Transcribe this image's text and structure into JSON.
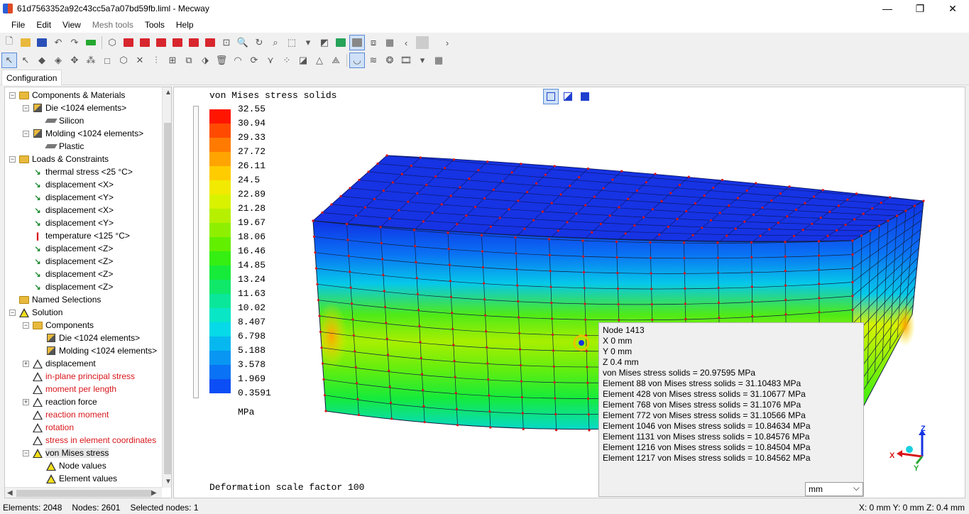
{
  "window": {
    "title": "61d7563352a92c43cc5a7a07bd59fb.liml - Mecway",
    "buttons": [
      "—",
      "❐",
      "✕"
    ]
  },
  "menu": [
    {
      "label": "File",
      "enabled": true
    },
    {
      "label": "Edit",
      "enabled": true
    },
    {
      "label": "View",
      "enabled": true
    },
    {
      "label": "Mesh tools",
      "enabled": false
    },
    {
      "label": "Tools",
      "enabled": true
    },
    {
      "label": "Help",
      "enabled": true
    }
  ],
  "tabs": {
    "configuration": "Configuration"
  },
  "tree": [
    {
      "label": "Components & Materials",
      "level": 0,
      "icon": "folder-icon",
      "toggle": "−"
    },
    {
      "label": "Die <1024 elements>",
      "level": 1,
      "icon": "component-icon",
      "toggle": "−"
    },
    {
      "label": "Silicon",
      "level": 2,
      "icon": "material-icon",
      "toggle": ""
    },
    {
      "label": "Molding <1024 elements>",
      "level": 1,
      "icon": "component-icon",
      "toggle": "−"
    },
    {
      "label": "Plastic",
      "level": 2,
      "icon": "material-icon",
      "toggle": ""
    },
    {
      "label": "Loads & Constraints",
      "level": 0,
      "icon": "folder-icon",
      "toggle": "−"
    },
    {
      "label": "thermal stress <25 °C>",
      "level": 1,
      "icon": "load-icon",
      "toggle": ""
    },
    {
      "label": "displacement <X>",
      "level": 1,
      "icon": "load-icon",
      "toggle": ""
    },
    {
      "label": "displacement <Y>",
      "level": 1,
      "icon": "load-icon",
      "toggle": ""
    },
    {
      "label": "displacement <X>",
      "level": 1,
      "icon": "load-icon",
      "toggle": ""
    },
    {
      "label": "displacement <Y>",
      "level": 1,
      "icon": "load-icon",
      "toggle": ""
    },
    {
      "label": "temperature <125 °C>",
      "level": 1,
      "icon": "thermometer-icon",
      "toggle": ""
    },
    {
      "label": "displacement <Z>",
      "level": 1,
      "icon": "load-icon",
      "toggle": ""
    },
    {
      "label": "displacement <Z>",
      "level": 1,
      "icon": "load-icon",
      "toggle": ""
    },
    {
      "label": "displacement <Z>",
      "level": 1,
      "icon": "load-icon",
      "toggle": ""
    },
    {
      "label": "displacement <Z>",
      "level": 1,
      "icon": "load-icon",
      "toggle": ""
    },
    {
      "label": "Named Selections",
      "level": 0,
      "icon": "folder-icon",
      "toggle": ""
    },
    {
      "label": "Solution",
      "level": 0,
      "icon": "solution-icon",
      "toggle": "−"
    },
    {
      "label": "Components",
      "level": 1,
      "icon": "folder-icon",
      "toggle": "−"
    },
    {
      "label": "Die <1024 elements>",
      "level": 2,
      "icon": "component-icon",
      "toggle": ""
    },
    {
      "label": "Molding <1024 elements>",
      "level": 2,
      "icon": "component-icon",
      "toggle": ""
    },
    {
      "label": "displacement",
      "level": 1,
      "icon": "result-icon",
      "toggle": "+"
    },
    {
      "label": "in-plane principal stress",
      "level": 1,
      "icon": "result-icon",
      "toggle": "",
      "red": true
    },
    {
      "label": "moment per length",
      "level": 1,
      "icon": "result-icon",
      "toggle": "",
      "red": true
    },
    {
      "label": "reaction force",
      "level": 1,
      "icon": "result-icon",
      "toggle": "+"
    },
    {
      "label": "reaction moment",
      "level": 1,
      "icon": "result-icon",
      "toggle": "",
      "red": true
    },
    {
      "label": "rotation",
      "level": 1,
      "icon": "result-icon",
      "toggle": "",
      "red": true
    },
    {
      "label": "stress in element coordinates",
      "level": 1,
      "icon": "result-icon",
      "toggle": "",
      "red": true
    },
    {
      "label": "von Mises stress",
      "level": 1,
      "icon": "result-icon",
      "toggle": "−",
      "selected": true
    },
    {
      "label": "Node values",
      "level": 2,
      "icon": "result-icon",
      "toggle": ""
    },
    {
      "label": "Element values",
      "level": 2,
      "icon": "result-icon",
      "toggle": ""
    }
  ],
  "legend": {
    "title": "von Mises stress solids",
    "unit": "MPa",
    "values": [
      "32.55",
      "30.94",
      "29.33",
      "27.72",
      "26.11",
      "24.5",
      "22.89",
      "21.28",
      "19.67",
      "18.06",
      "16.46",
      "14.85",
      "13.24",
      "11.63",
      "10.02",
      "8.407",
      "6.798",
      "5.188",
      "3.578",
      "1.969",
      "0.3591"
    ],
    "colors": [
      "#ff1500",
      "#ff4a00",
      "#ff7a00",
      "#ffa400",
      "#ffcc00",
      "#f2ea00",
      "#d8f200",
      "#b6f000",
      "#8ef000",
      "#62ef00",
      "#35ee12",
      "#16eb3a",
      "#10e86a",
      "#0ae79a",
      "#08e6c6",
      "#06d9e8",
      "#06b8ef",
      "#0896f2",
      "#0a72f4",
      "#0c4ef5",
      "#0e22f4"
    ]
  },
  "deformation": "Deformation scale factor 100",
  "node_info": {
    "lines": [
      "Node  1413",
      "X  0 mm",
      "Y  0 mm",
      "Z  0.4 mm",
      "von Mises stress solids = 20.97595 MPa",
      "Element 88 von Mises stress solids = 31.10483 MPa",
      "Element 428 von Mises stress solids = 31.10677 MPa",
      "Element 768 von Mises stress solids = 31.1076 MPa",
      "Element 772 von Mises stress solids = 31.10566 MPa",
      "Element 1046 von Mises stress solids = 10.84634 MPa",
      "Element 1131 von Mises stress solids = 10.84576 MPa",
      "Element 1216 von Mises stress solids = 10.84504 MPa",
      "Element 1217 von Mises stress solids = 10.84562 MPa"
    ],
    "unit_select": "mm"
  },
  "axes": {
    "x": "X",
    "y": "Y",
    "z": "Z"
  },
  "status": {
    "elements": "Elements: 2048",
    "nodes": "Nodes: 2601",
    "selected": "Selected nodes: 1",
    "coords": "X: 0 mm Y: 0 mm Z: 0.4 mm"
  }
}
